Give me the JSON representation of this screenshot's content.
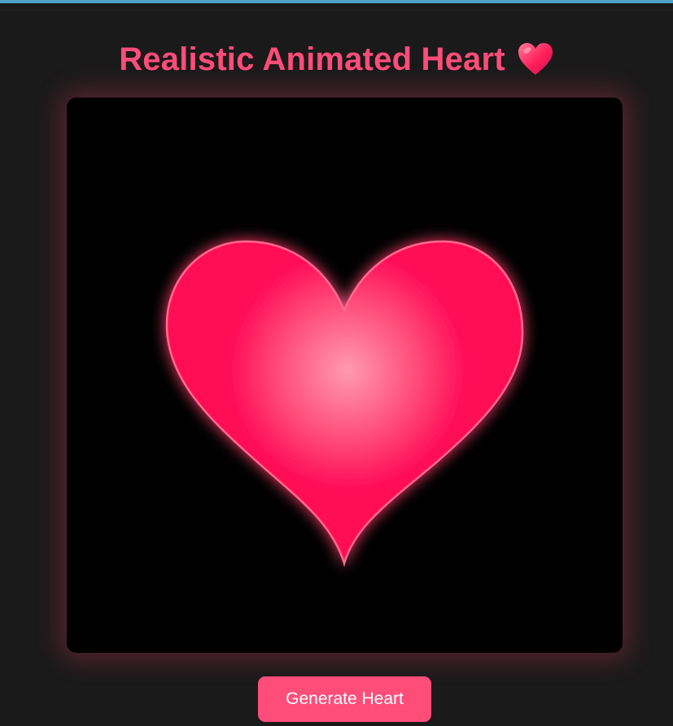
{
  "page": {
    "title": "Realistic Animated Heart",
    "title_emoji": "heart-icon"
  },
  "canvas": {
    "background": "#000000",
    "heart_icon": "heart-icon"
  },
  "controls": {
    "generate_label": "Generate Heart"
  },
  "colors": {
    "accent": "#ff4d7a",
    "heart_core": "#ff0a55",
    "heart_highlight": "#ff9ab0",
    "page_bg": "#1a1a1a",
    "top_strip": "#4fa3c7"
  }
}
